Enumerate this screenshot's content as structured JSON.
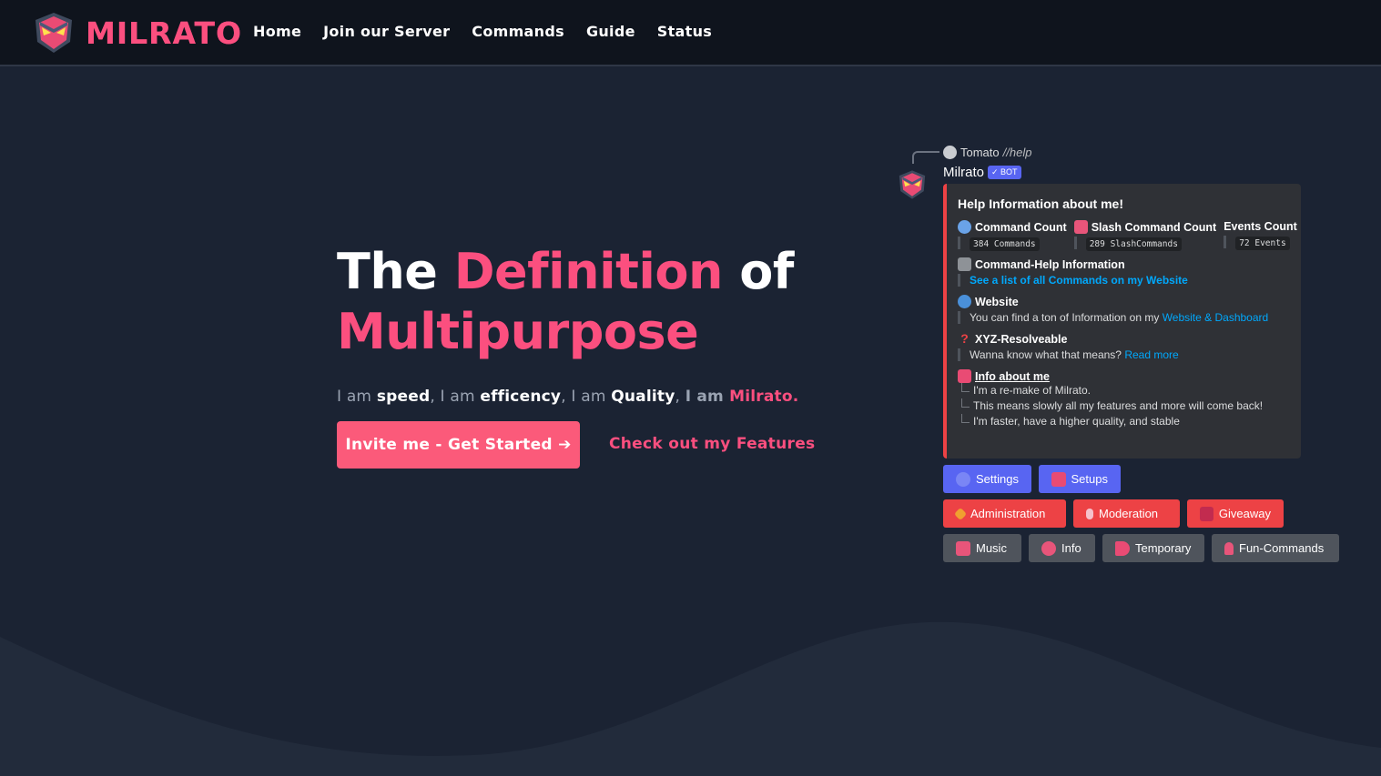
{
  "nav": {
    "brand": "MILRATO",
    "links": [
      "Home",
      "Join our Server",
      "Commands",
      "Guide",
      "Status"
    ]
  },
  "hero": {
    "title_1": "The ",
    "title_2": "Definition",
    "title_3": " of",
    "title_4": "Multipurpose",
    "sub_1": "I am ",
    "sub_2": "speed",
    "sub_3": ", I am ",
    "sub_4": "efficency",
    "sub_5": ", I am ",
    "sub_6": "Quality",
    "sub_7": ", ",
    "sub_8": "I am ",
    "sub_9": "Milrato.",
    "invite_button": "Invite me - Get Started ➔",
    "features_link": "Check out my Features"
  },
  "preview": {
    "reply_user": "Tomato",
    "reply_command": "//help",
    "bot_name": "Milrato",
    "bot_tag": "✓ BOT",
    "embed": {
      "title": "Help Information about me!",
      "fields": [
        {
          "name": "Command Count",
          "value": "384 Commands"
        },
        {
          "name": "Slash Command Count",
          "value": "289 SlashCommands"
        },
        {
          "name": "Events Count",
          "value": "72 Events"
        }
      ],
      "help_name": "Command-Help Information",
      "help_value": "See a list of all Commands on my Website",
      "website_name": "Website",
      "website_text": "You can find a ton of Information on my ",
      "website_link": "Website & Dashboard",
      "xyz_name": "XYZ-Resolveable",
      "xyz_text": "Wanna know what that means? ",
      "xyz_link": "Read more",
      "info_name": "Info about me",
      "info_lines": [
        "I'm a re-make of Milrato.",
        "This means slowly all my features and more will come back!",
        "I'm faster, have a higher quality, and stable"
      ]
    },
    "buttons_row1": [
      "Settings",
      "Setups"
    ],
    "buttons_row2": [
      "Administration",
      "Moderation",
      "Giveaway"
    ],
    "buttons_row3": [
      "Music",
      "Info",
      "Temporary",
      "Fun-Commands"
    ]
  },
  "colors": {
    "accent": "#fb4f7f",
    "background": "#1b2333",
    "navbar": "#0f141d",
    "discord_blurple": "#5865f2",
    "discord_red": "#ed4245",
    "discord_grey": "#4f545c"
  }
}
